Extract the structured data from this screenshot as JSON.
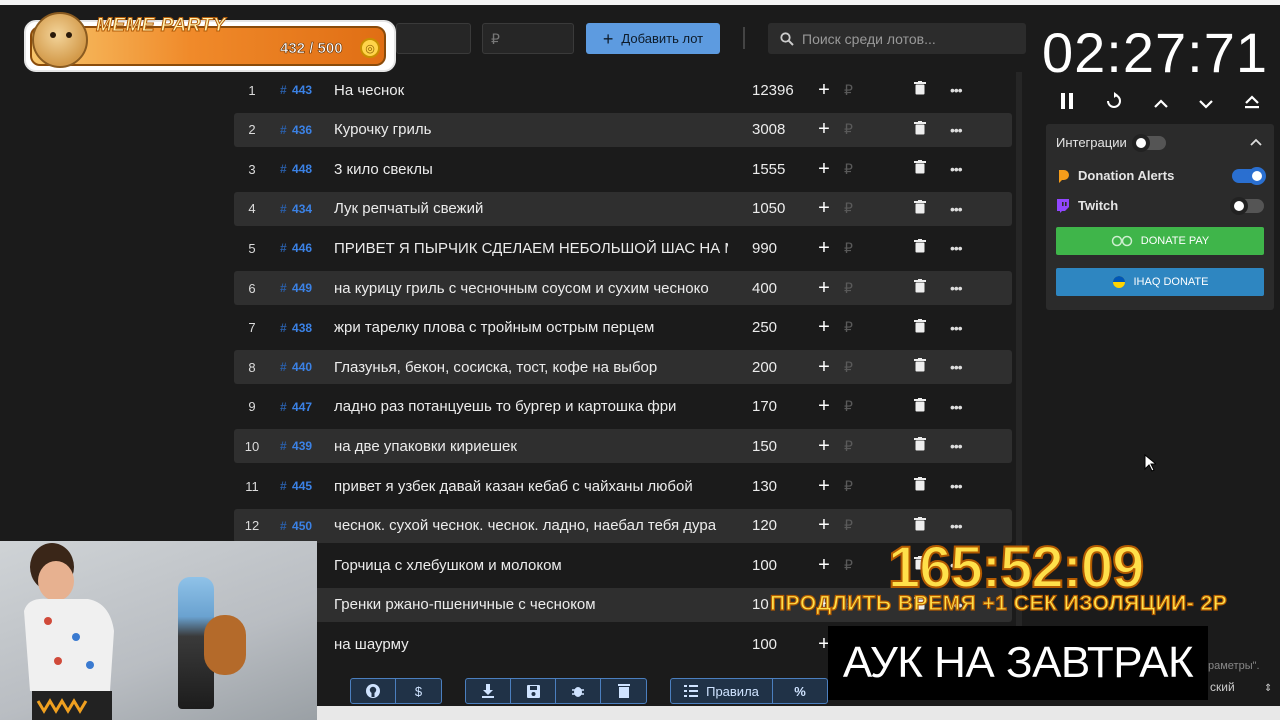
{
  "toolbar": {
    "name_placeholder": "",
    "amount_placeholder": "₽",
    "add_label": "Добавить лот",
    "search_placeholder": "Поиск среди лотов..."
  },
  "meme": {
    "title": "MEME PARTY",
    "count": "432 / 500"
  },
  "lots": [
    {
      "num": "1",
      "id": "443",
      "name": "На чеснок",
      "amount": "12396"
    },
    {
      "num": "2",
      "id": "436",
      "name": "Курочку гриль",
      "amount": "3008"
    },
    {
      "num": "3",
      "id": "448",
      "name": "3 кило свеклы",
      "amount": "1555"
    },
    {
      "num": "4",
      "id": "434",
      "name": "Лук репчатый свежий",
      "amount": "1050"
    },
    {
      "num": "5",
      "id": "446",
      "name": "ПРИВЕТ Я ПЫРЧИК СДЕЛАЕМ НЕБОЛЬШОЙ ШАС НА М",
      "amount": "990"
    },
    {
      "num": "6",
      "id": "449",
      "name": "на курицу гриль с чесночным соусом и сухим чесноко",
      "amount": "400"
    },
    {
      "num": "7",
      "id": "438",
      "name": "жри тарелку плова с тройным острым перцем",
      "amount": "250"
    },
    {
      "num": "8",
      "id": "440",
      "name": " Глазунья, бекон, сосиска, тост, кофе на выбор",
      "amount": "200"
    },
    {
      "num": "9",
      "id": "447",
      "name": "ладно раз потанцуешь то бургер и картошка фри",
      "amount": "170"
    },
    {
      "num": "10",
      "id": "439",
      "name": "на две упаковки кириешек",
      "amount": "150"
    },
    {
      "num": "11",
      "id": "445",
      "name": "привет я узбек давай казан кебаб с чайханы любой",
      "amount": "130"
    },
    {
      "num": "12",
      "id": "450",
      "name": "чеснок. сухой чеснок. чеснок. ладно, наебал тебя дура",
      "amount": "120"
    },
    {
      "num": "",
      "id": "",
      "name": "Горчица с хлебушком и молоком",
      "amount": "100"
    },
    {
      "num": "",
      "id": "",
      "name": "Гренки ржано-пшеничные с чесноком",
      "amount": "10"
    },
    {
      "num": "",
      "id": "",
      "name": " на шаурму",
      "amount": "100"
    }
  ],
  "bottom": {
    "rules_label": "Правила",
    "percent_label": "%",
    "dollar_label": "$",
    "lang": "ский"
  },
  "timer": "02:27:71",
  "integrations": {
    "title": "Интеграции",
    "donation_alerts": "Donation Alerts",
    "twitch": "Twitch",
    "donate_pay": "DONATE PAY",
    "ihaq": "IHAQ DONATE"
  },
  "overlay": {
    "big_timer": "165:52:09",
    "promo": "ПРОДЛИТЬ ВРЕМЯ +1 СЕК ИЗОЛЯЦИИ- 2Р",
    "auk": "АУК НА ЗАВТРАК",
    "hint": "раметры\"."
  },
  "colors": {
    "accent": "#5d9be0",
    "donate_pay": "#3fb54a",
    "ihaq": "#2e86c1",
    "id_blue": "#3b82e6"
  }
}
